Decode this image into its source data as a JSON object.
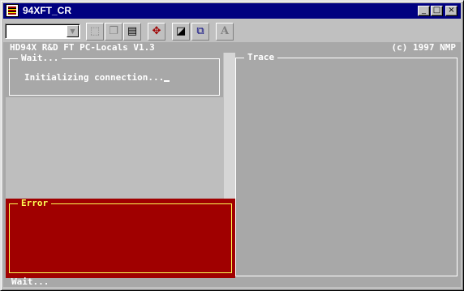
{
  "window": {
    "title": "94XFT_CR",
    "icon": "dos-app-icon",
    "controls": {
      "minimize": "_",
      "maximize": "□",
      "close": "×"
    }
  },
  "toolbar": {
    "font_combo": {
      "value": ""
    },
    "buttons": [
      {
        "name": "mark-button",
        "icon": "mark-icon",
        "glyph": "⬚"
      },
      {
        "name": "copy-button",
        "icon": "copy-icon",
        "glyph": "❐"
      },
      {
        "name": "paste-button",
        "icon": "paste-icon",
        "glyph": "▤"
      },
      {
        "name": "fullscreen-button",
        "icon": "fullscreen-icon",
        "glyph": "✥"
      },
      {
        "name": "properties-button",
        "icon": "properties-icon",
        "glyph": "◪"
      },
      {
        "name": "background-button",
        "icon": "background-icon",
        "glyph": "⧉"
      },
      {
        "name": "font-button",
        "icon": "font-icon",
        "glyph": "A"
      }
    ]
  },
  "console": {
    "header_left": "HD94X R&D FT PC-Locals V1.3",
    "header_right": "(c) 1997 NMP",
    "wait_panel": {
      "title": "Wait...",
      "message": "Initializing connection..."
    },
    "trace_panel": {
      "title": "Trace"
    },
    "error_panel": {
      "title": "Error"
    },
    "status_line": "Wait..."
  },
  "colors": {
    "titlebar": "#000080",
    "console_bg": "#a8a8a8",
    "error_bg": "#a00000",
    "error_border": "#ffff55",
    "text": "#ffffff"
  }
}
